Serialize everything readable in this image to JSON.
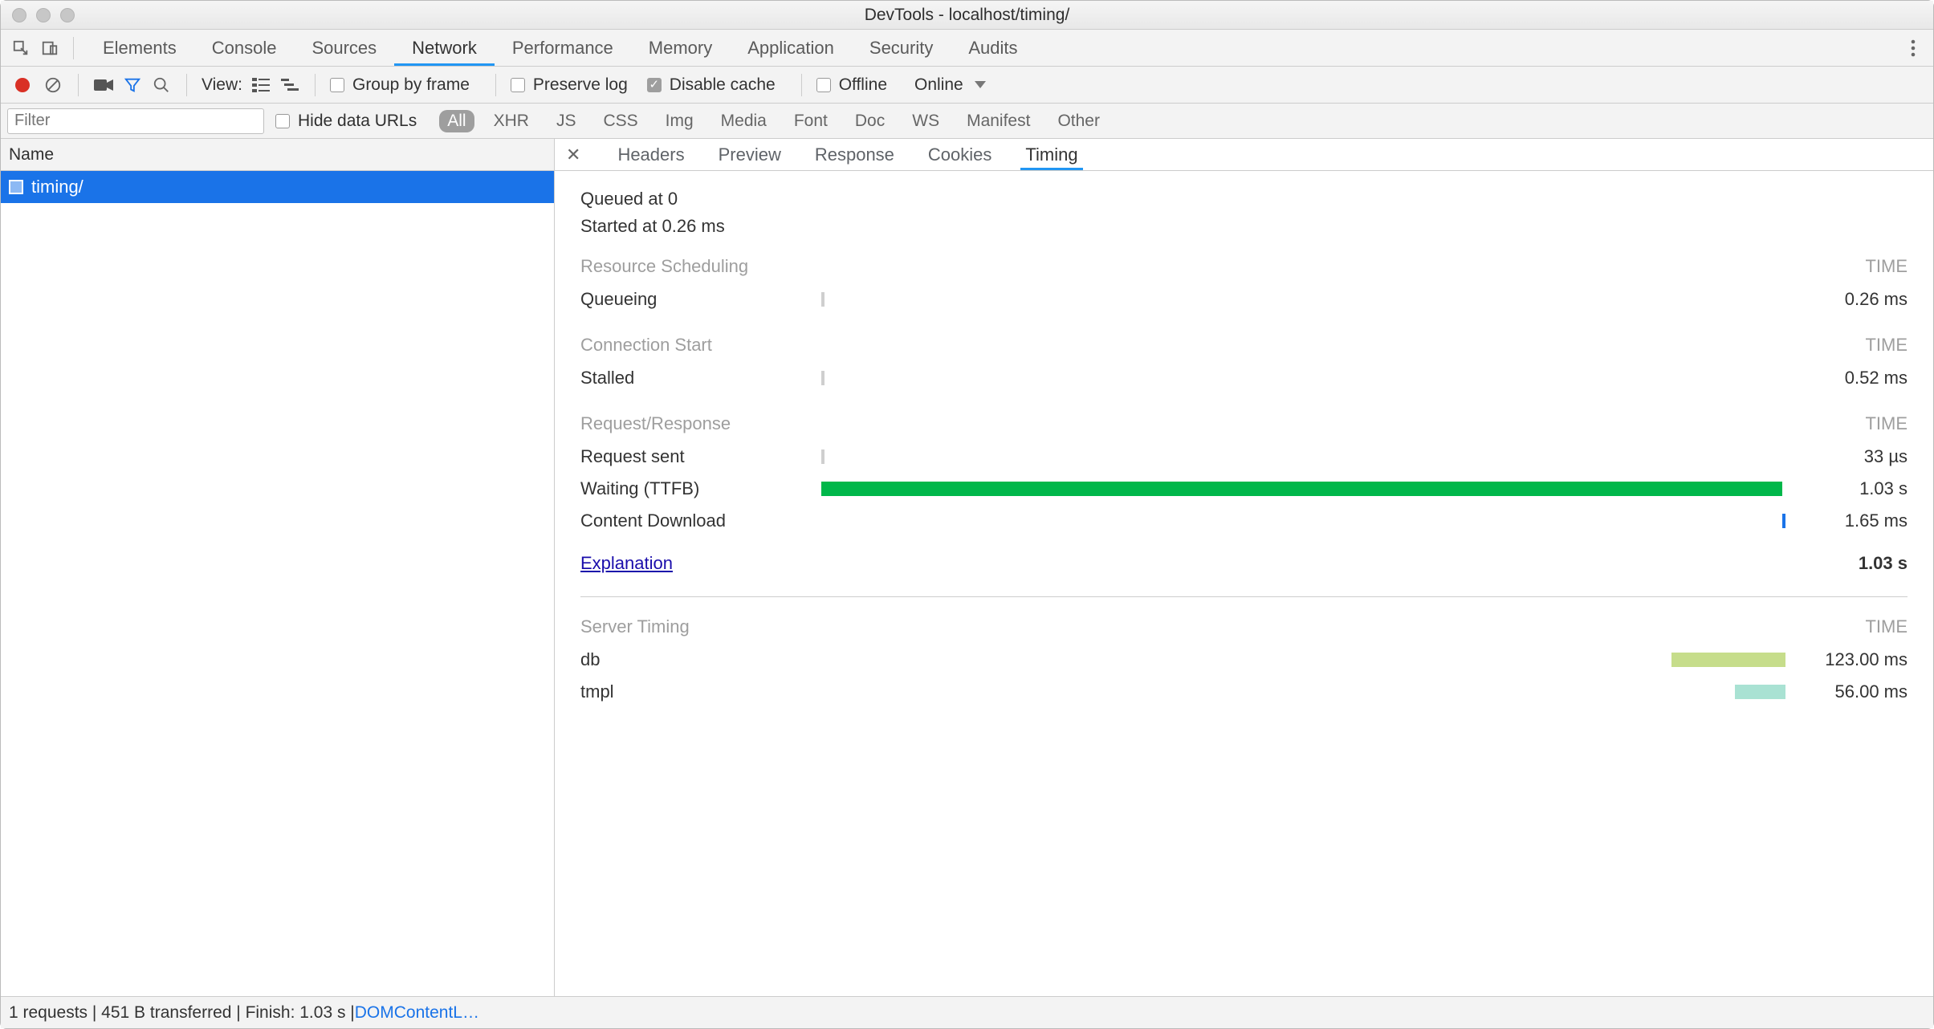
{
  "window": {
    "title": "DevTools - localhost/timing/"
  },
  "tabs": {
    "items": [
      "Elements",
      "Console",
      "Sources",
      "Network",
      "Performance",
      "Memory",
      "Application",
      "Security",
      "Audits"
    ],
    "active": "Network"
  },
  "toolbar": {
    "view_label": "View:",
    "group_by_frame": "Group by frame",
    "preserve_log": "Preserve log",
    "disable_cache": "Disable cache",
    "disable_cache_checked": true,
    "offline": "Offline",
    "online_select": "Online"
  },
  "filter": {
    "placeholder": "Filter",
    "hide_data_urls": "Hide data URLs",
    "types": [
      "All",
      "XHR",
      "JS",
      "CSS",
      "Img",
      "Media",
      "Font",
      "Doc",
      "WS",
      "Manifest",
      "Other"
    ],
    "active_type": "All"
  },
  "requests": {
    "column_name": "Name",
    "rows": [
      {
        "name": "timing/"
      }
    ],
    "selected_index": 0
  },
  "detail_tabs": {
    "items": [
      "Headers",
      "Preview",
      "Response",
      "Cookies",
      "Timing"
    ],
    "active": "Timing"
  },
  "timing": {
    "queued_at": "Queued at 0",
    "started_at": "Started at 0.26 ms",
    "time_header": "TIME",
    "sections": [
      {
        "title": "Resource Scheduling",
        "metrics": [
          {
            "name": "Queueing",
            "value": "0.26 ms",
            "left_pct": 0.0,
            "width_pct": 0.3,
            "color": "#cfcfcf"
          }
        ]
      },
      {
        "title": "Connection Start",
        "metrics": [
          {
            "name": "Stalled",
            "value": "0.52 ms",
            "left_pct": 0.0,
            "width_pct": 0.3,
            "color": "#cfcfcf"
          }
        ]
      },
      {
        "title": "Request/Response",
        "metrics": [
          {
            "name": "Request sent",
            "value": "33 µs",
            "left_pct": 0.0,
            "width_pct": 0.3,
            "color": "#cfcfcf"
          },
          {
            "name": "Waiting (TTFB)",
            "value": "1.03 s",
            "left_pct": 0.0,
            "width_pct": 99.5,
            "color": "#00b74a"
          },
          {
            "name": "Content Download",
            "value": "1.65 ms",
            "left_pct": 99.5,
            "width_pct": 0.3,
            "color": "#1a73e8"
          }
        ]
      }
    ],
    "explanation_label": "Explanation",
    "total": "1.03 s",
    "server_timing": {
      "title": "Server Timing",
      "metrics": [
        {
          "name": "db",
          "value": "123.00 ms",
          "left_pct": 88.0,
          "width_pct": 11.8,
          "color": "#c6dd8b"
        },
        {
          "name": "tmpl",
          "value": "56.00 ms",
          "left_pct": 94.6,
          "width_pct": 5.2,
          "color": "#a9e2d3"
        }
      ]
    }
  },
  "status": {
    "text_prefix": "1 requests | 451 B transferred | Finish: 1.03 s | ",
    "dom_link": "DOMContentL…"
  }
}
